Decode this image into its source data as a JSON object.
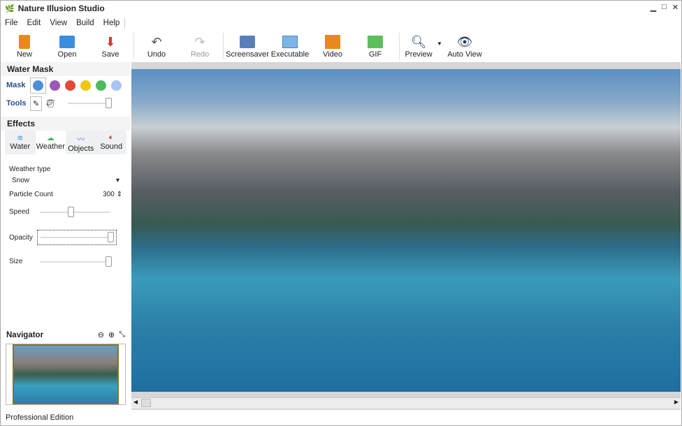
{
  "app": {
    "title": "Nature Illusion Studio",
    "edition": "Professional Edition"
  },
  "menu": [
    "File",
    "Edit",
    "View",
    "Build",
    "Help"
  ],
  "toolbar": {
    "new": "New",
    "open": "Open",
    "save": "Save",
    "undo": "Undo",
    "redo": "Redo",
    "screensaver": "Screensaver",
    "executable": "Executable",
    "video": "Video",
    "gif": "GIF",
    "preview": "Preview",
    "autoview": "Auto View"
  },
  "water_mask": {
    "title": "Water Mask",
    "mask_label": "Mask",
    "tools_label": "Tools",
    "colors": [
      "#4a90d9",
      "#9b59b6",
      "#e04a3a",
      "#f1c40f",
      "#4cbb5c",
      "#a9c4ef"
    ],
    "selected_color": 0,
    "tool_slider": 0.9
  },
  "effects": {
    "title": "Effects",
    "tabs": [
      "Water",
      "Weather",
      "Objects",
      "Sound"
    ],
    "active_tab": 1,
    "weather_type_label": "Weather type",
    "weather_type": "Snow",
    "particle_label": "Particle Count",
    "particle_count": "300",
    "speed_label": "Speed",
    "speed": 0.45,
    "opacity_label": "Opacity",
    "opacity": 1.0,
    "size_label": "Size",
    "size": 1.0
  },
  "navigator": {
    "title": "Navigator"
  }
}
